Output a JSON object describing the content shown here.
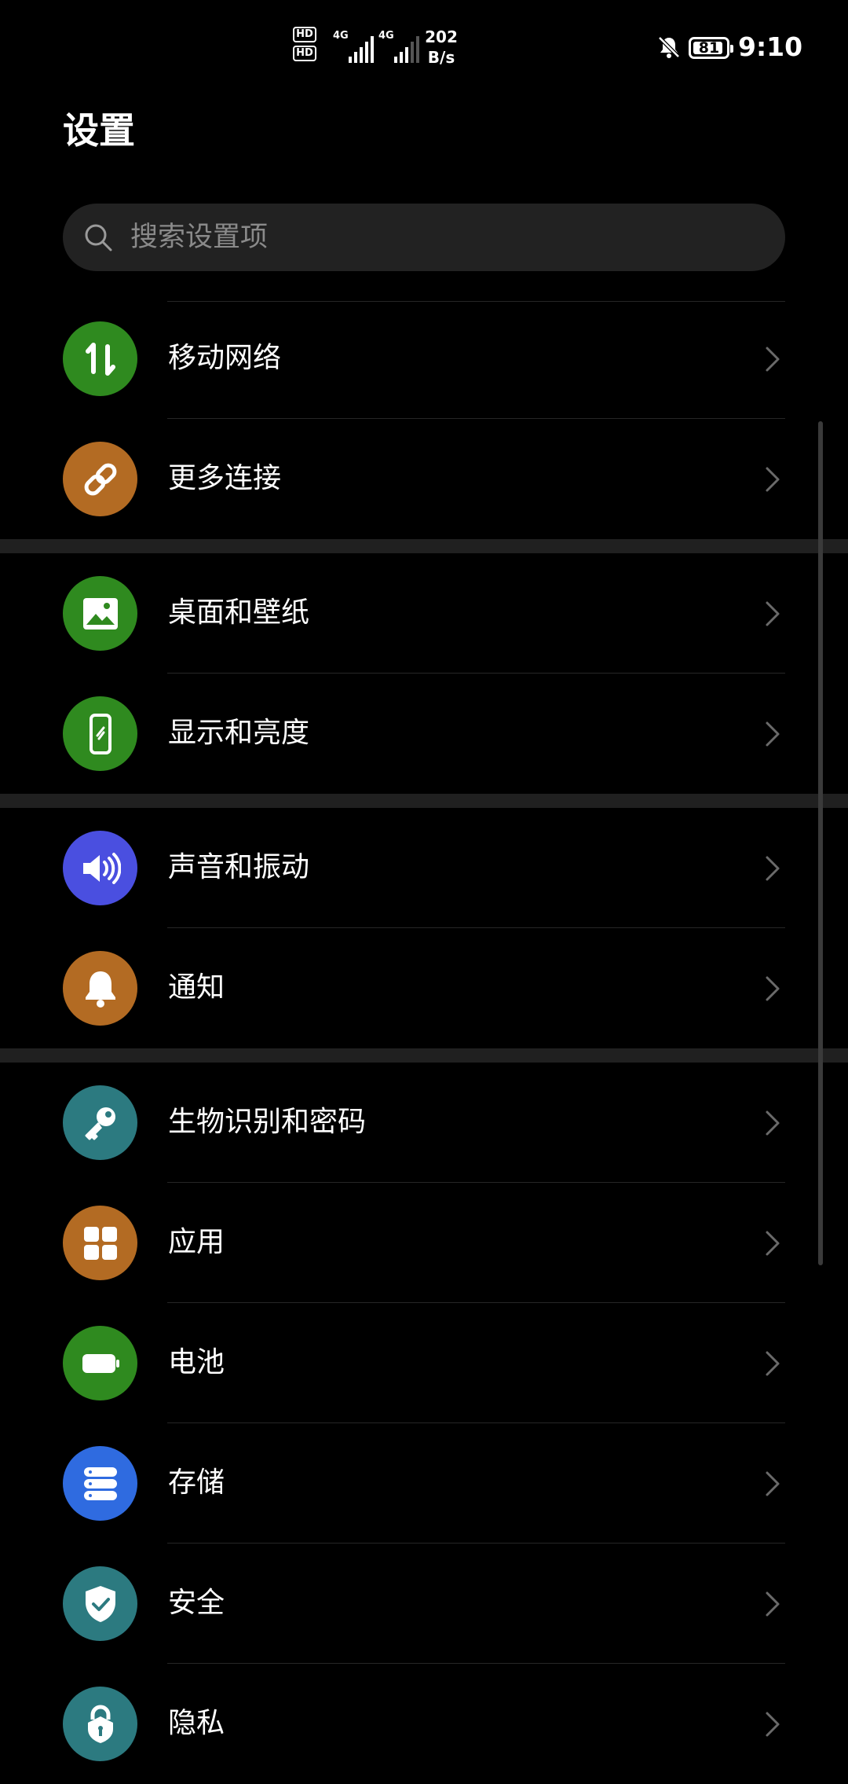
{
  "status_bar": {
    "hd1": "HD",
    "hd2": "HD",
    "sim1_net": "4G",
    "sim2_net": "4G",
    "speed_value": "202",
    "speed_unit": "B/s",
    "battery": "81",
    "time": "9:10",
    "icons": [
      "hd-icon",
      "signal-icon",
      "mute-bell-icon",
      "battery-icon"
    ]
  },
  "page": {
    "title": "设置"
  },
  "search": {
    "placeholder": "搜索设置项",
    "value": ""
  },
  "groups": [
    {
      "items": [
        {
          "label": "移动网络",
          "icon": "mobile-data-icon",
          "color": "#2f8a1f"
        },
        {
          "label": "更多连接",
          "icon": "link-icon",
          "color": "#b36b23"
        }
      ]
    },
    {
      "items": [
        {
          "label": "桌面和壁纸",
          "icon": "wallpaper-icon",
          "color": "#2f8a1f"
        },
        {
          "label": "显示和亮度",
          "icon": "display-icon",
          "color": "#2f8a1f"
        }
      ]
    },
    {
      "items": [
        {
          "label": "声音和振动",
          "icon": "speaker-icon",
          "color": "#4a4fe0"
        },
        {
          "label": "通知",
          "icon": "bell-icon",
          "color": "#b36b23"
        }
      ]
    },
    {
      "items": [
        {
          "label": "生物识别和密码",
          "icon": "key-icon",
          "color": "#2c7a80"
        },
        {
          "label": "应用",
          "icon": "apps-icon",
          "color": "#b36b23"
        },
        {
          "label": "电池",
          "icon": "battery-icon",
          "color": "#2f8a1f"
        },
        {
          "label": "存储",
          "icon": "storage-icon",
          "color": "#2f6be0"
        },
        {
          "label": "安全",
          "icon": "shield-icon",
          "color": "#2c7a80"
        },
        {
          "label": "隐私",
          "icon": "privacy-lock-icon",
          "color": "#2c7a80"
        }
      ]
    }
  ]
}
